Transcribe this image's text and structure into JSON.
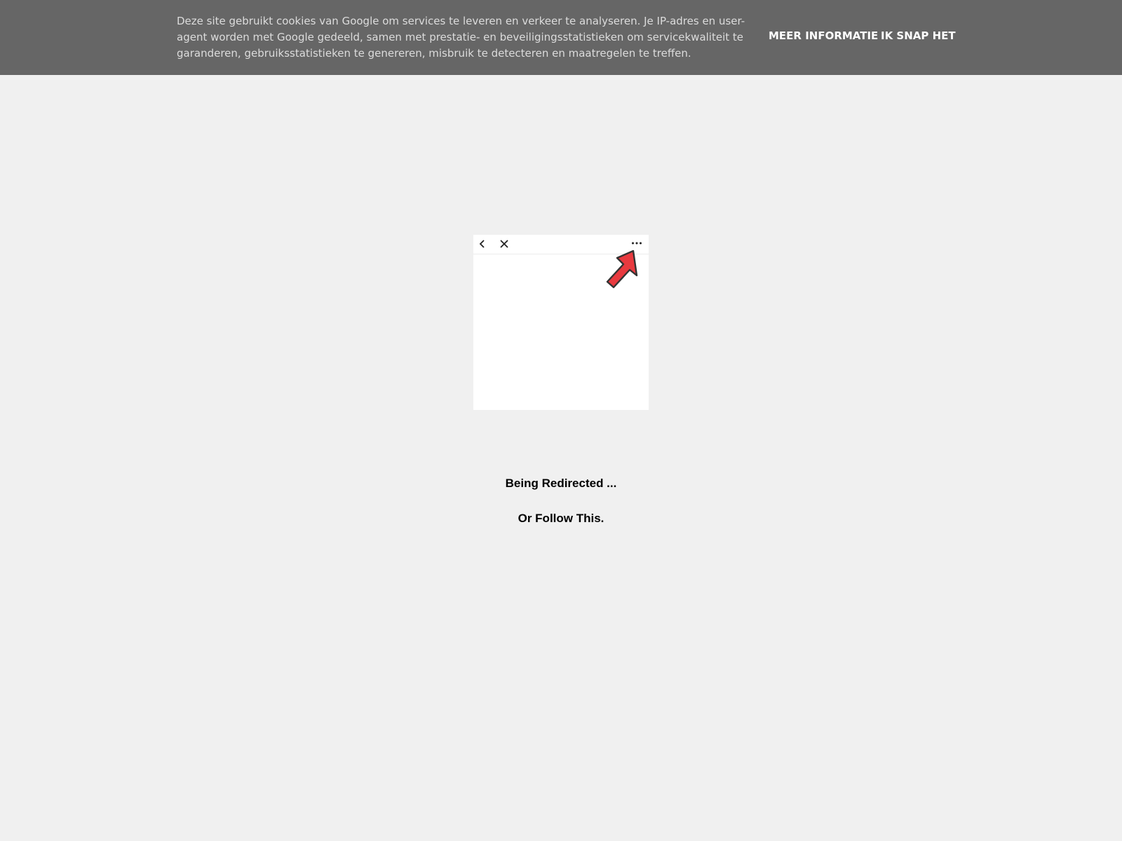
{
  "cookie_banner": {
    "message": "Deze site gebruikt cookies van Google om services te leveren en verkeer te analyseren. Je IP-adres en user-agent worden met Google gedeeld, samen met prestatie- en beveiligingsstatistieken om servicekwaliteit te garanderen, gebruiksstatistieken te genereren, misbruik te detecteren en maatregelen te treffen.",
    "more_info_label": "MEER INFORMATIE",
    "got_it_label": "IK SNAP HET",
    "background_color": "#666666"
  },
  "illustration": {
    "icons": [
      "back-icon",
      "close-icon",
      "more-icon",
      "pointer-arrow-icon"
    ],
    "arrow_color": "#e83a3f"
  },
  "main": {
    "status_text": "Being Redirected ...",
    "follow_link_text": "Or Follow This."
  }
}
